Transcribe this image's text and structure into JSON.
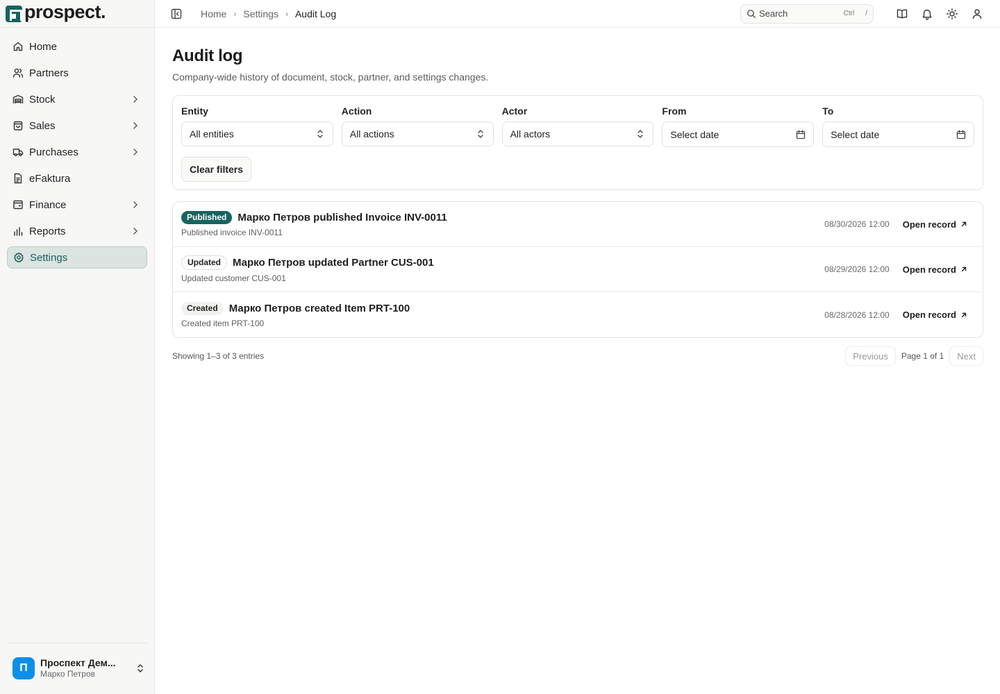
{
  "brand": {
    "name": "prospect.",
    "color": "#17635f"
  },
  "sidebar": {
    "items": [
      {
        "label": "Home",
        "icon": "home-icon",
        "has_children": false,
        "active": false
      },
      {
        "label": "Partners",
        "icon": "users-icon",
        "has_children": false,
        "active": false
      },
      {
        "label": "Stock",
        "icon": "warehouse-icon",
        "has_children": true,
        "active": false
      },
      {
        "label": "Sales",
        "icon": "shopping-bag-icon",
        "has_children": true,
        "active": false
      },
      {
        "label": "Purchases",
        "icon": "truck-icon",
        "has_children": true,
        "active": false
      },
      {
        "label": "eFaktura",
        "icon": "file-text-icon",
        "has_children": false,
        "active": false
      },
      {
        "label": "Finance",
        "icon": "wallet-icon",
        "has_children": true,
        "active": false
      },
      {
        "label": "Reports",
        "icon": "bar-chart-icon",
        "has_children": true,
        "active": false
      },
      {
        "label": "Settings",
        "icon": "gear-icon",
        "has_children": false,
        "active": true
      }
    ],
    "org": {
      "initial": "П",
      "name": "Проспект Дем...",
      "user": "Марко Петров",
      "avatar_color": "#0d8fe6"
    }
  },
  "topbar": {
    "breadcrumb": [
      "Home",
      "Settings",
      "Audit Log"
    ],
    "search": {
      "label": "Search",
      "shortcut_ctrl": "Ctrl",
      "shortcut_key": "/"
    }
  },
  "page": {
    "title": "Audit log",
    "subtitle": "Company-wide history of document, stock, partner, and settings changes."
  },
  "filters": {
    "entity": {
      "label": "Entity",
      "value": "All entities"
    },
    "action": {
      "label": "Action",
      "value": "All actions"
    },
    "actor": {
      "label": "Actor",
      "value": "All actors"
    },
    "from": {
      "label": "From",
      "placeholder": "Select date"
    },
    "to": {
      "label": "To",
      "placeholder": "Select date"
    },
    "clear_label": "Clear filters"
  },
  "log": {
    "open_label": "Open record",
    "entries": [
      {
        "badge": "Published",
        "badge_style": "published",
        "title": "Марко Петров published Invoice INV-0011",
        "desc": "Published invoice INV-0011",
        "time": "08/30/2026 12:00"
      },
      {
        "badge": "Updated",
        "badge_style": "updated",
        "title": "Марко Петров updated Partner CUS-001",
        "desc": "Updated customer CUS-001",
        "time": "08/29/2026 12:00"
      },
      {
        "badge": "Created",
        "badge_style": "created",
        "title": "Марко Петров created Item PRT-100",
        "desc": "Created item PRT-100",
        "time": "08/28/2026 12:00"
      }
    ]
  },
  "pagination": {
    "showing": "Showing 1–3 of 3 entries",
    "previous": "Previous",
    "page_info": "Page 1 of 1",
    "next": "Next"
  }
}
